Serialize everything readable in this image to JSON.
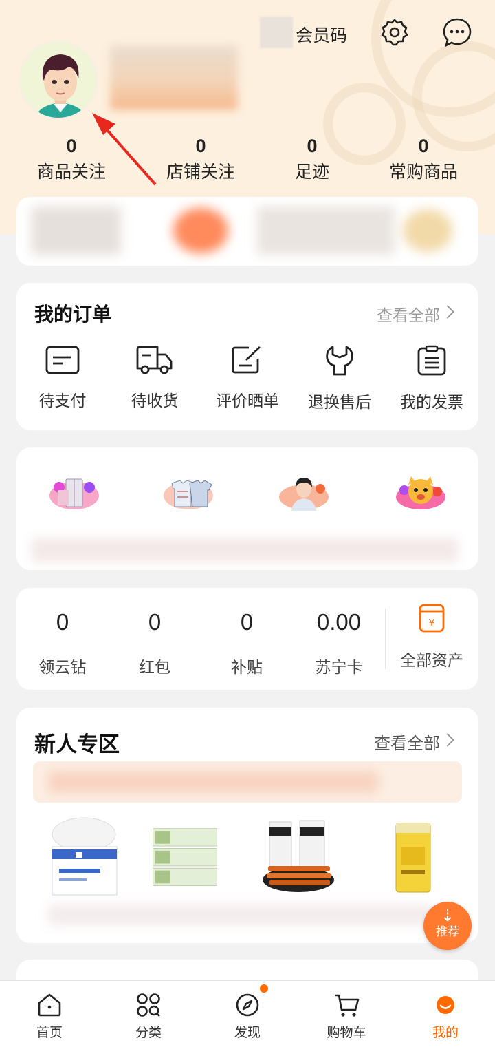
{
  "header": {
    "member_code_label": "会员码",
    "settings_icon": "gear-icon",
    "message_icon": "chat-bubble-icon"
  },
  "stats": [
    {
      "value": "0",
      "label": "商品关注"
    },
    {
      "value": "0",
      "label": "店铺关注"
    },
    {
      "value": "0",
      "label": "足迹"
    },
    {
      "value": "0",
      "label": "常购商品"
    }
  ],
  "orders": {
    "title": "我的订单",
    "view_all": "查看全部",
    "items": [
      {
        "label": "待支付",
        "icon": "wallet-icon"
      },
      {
        "label": "待收货",
        "icon": "truck-icon"
      },
      {
        "label": "评价晒单",
        "icon": "edit-icon"
      },
      {
        "label": "退换售后",
        "icon": "wrench-icon"
      },
      {
        "label": "我的发票",
        "icon": "invoice-icon"
      }
    ]
  },
  "assets": {
    "items": [
      {
        "value": "0",
        "label": "领云钻"
      },
      {
        "value": "0",
        "label": "红包"
      },
      {
        "value": "0",
        "label": "补贴"
      },
      {
        "value": "0.00",
        "label": "苏宁卡"
      }
    ],
    "all_assets_label": "全部资产",
    "all_assets_icon": "yuan-card-icon"
  },
  "newcomer": {
    "title": "新人专区",
    "view_all": "查看全部"
  },
  "fab": {
    "label": "推荐",
    "icon": "down-arrow-icon"
  },
  "tabs": [
    {
      "label": "首页",
      "icon": "home-icon"
    },
    {
      "label": "分类",
      "icon": "grid-icon"
    },
    {
      "label": "发现",
      "icon": "compass-icon"
    },
    {
      "label": "购物车",
      "icon": "cart-icon"
    },
    {
      "label": "我的",
      "icon": "profile-icon"
    }
  ],
  "colors": {
    "accent": "#ff6a00",
    "hero_bg": "#fdf0de",
    "page_bg": "#f2f2f2"
  }
}
